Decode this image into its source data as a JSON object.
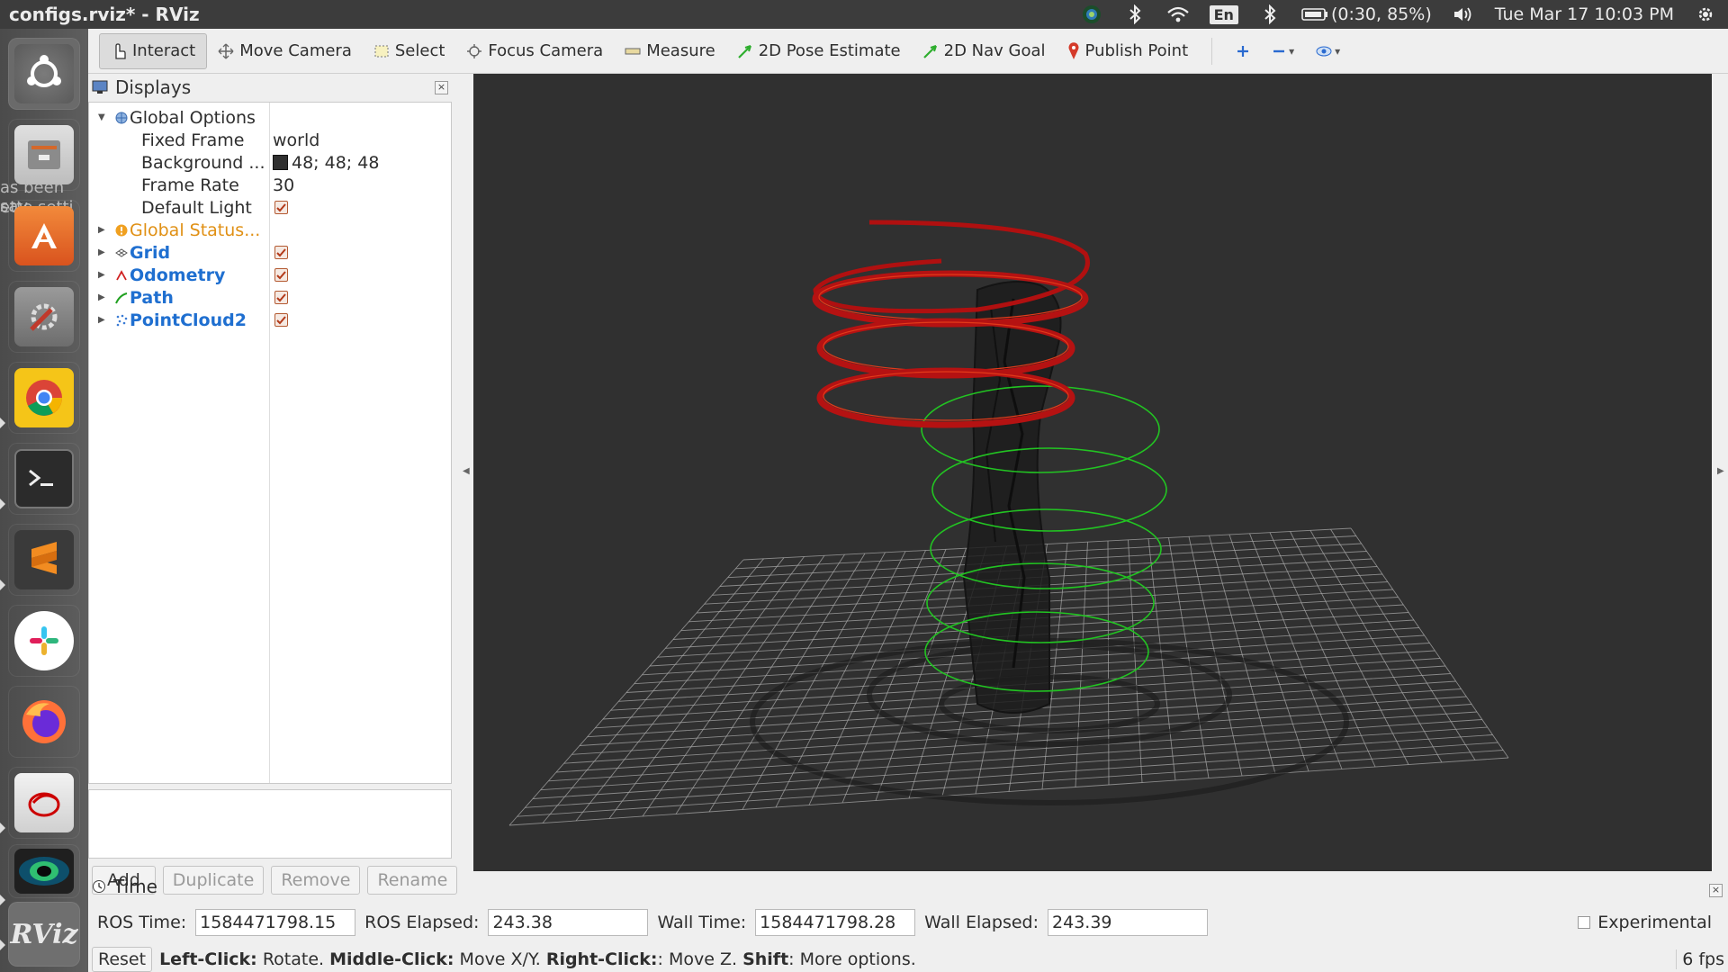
{
  "window": {
    "title": "configs.rviz* - RViz"
  },
  "panel": {
    "language": "En",
    "battery": "(0:30, 85%)",
    "datetime": "Tue Mar 17 10:03 PM"
  },
  "launcher": {
    "items": [
      "ubuntu-dash-icon",
      "files-icon",
      "software-center-icon",
      "system-settings-icon",
      "chrome-icon",
      "terminal-icon",
      "sublime-text-icon",
      "slack-icon",
      "firefox-icon",
      "eclipse-icon",
      "rviz-camera-icon",
      "rviz-icon"
    ],
    "rviz_label": "RViz",
    "ghost_text": [
      "as been sav",
      "ette setti"
    ]
  },
  "toolbar": {
    "interact": "Interact",
    "move_camera": "Move Camera",
    "select": "Select",
    "focus_camera": "Focus Camera",
    "measure": "Measure",
    "pose_estimate": "2D Pose Estimate",
    "nav_goal": "2D Nav Goal",
    "publish_point": "Publish Point"
  },
  "displays": {
    "title": "Displays",
    "global_options": "Global Options",
    "fixed_frame_label": "Fixed Frame",
    "fixed_frame_value": "world",
    "background_label": "Background ...",
    "background_value": "48; 48; 48",
    "frame_rate_label": "Frame Rate",
    "frame_rate_value": "30",
    "default_light_label": "Default Light",
    "global_status": "Global Status...",
    "grid": "Grid",
    "odometry": "Odometry",
    "path": "Path",
    "pointcloud": "PointCloud2",
    "buttons": {
      "add": "Add",
      "duplicate": "Duplicate",
      "remove": "Remove",
      "rename": "Rename"
    }
  },
  "time": {
    "title": "Time",
    "ros_time_label": "ROS Time:",
    "ros_time": "1584471798.15",
    "ros_elapsed_label": "ROS Elapsed:",
    "ros_elapsed": "243.38",
    "wall_time_label": "Wall Time:",
    "wall_time": "1584471798.28",
    "wall_elapsed_label": "Wall Elapsed:",
    "wall_elapsed": "243.39",
    "experimental": "Experimental"
  },
  "status": {
    "reset": "Reset",
    "left_click": "Left-Click:",
    "left_action": "Rotate.",
    "middle_click": "Middle-Click:",
    "middle_action": "Move X/Y.",
    "right_click": "Right-Click:",
    "right_action": ": Move Z.",
    "shift": "Shift",
    "shift_action": ": More options.",
    "fps": "6 fps"
  },
  "colors": {
    "viewport_bg": "#303030",
    "odometry": "#c01010",
    "path": "#20c020",
    "tree_blue": "#1f6fd0",
    "status_orange": "#e09014"
  }
}
